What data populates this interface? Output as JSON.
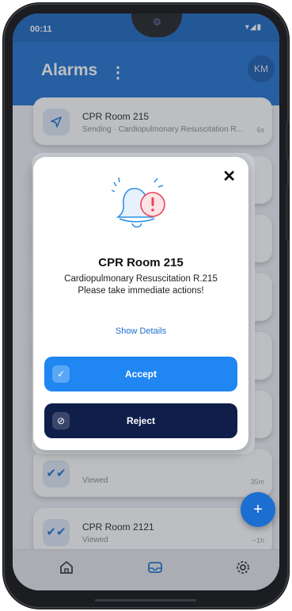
{
  "status_bar": {
    "time": "00:11",
    "icons": "▾◢▮"
  },
  "header": {
    "title": "Alarms",
    "menu_glyph": "⋮",
    "avatar_initials": "KM"
  },
  "list": [
    {
      "title": "CPR Room 215",
      "status": "Sending",
      "detail": "Cardiopulmonary Resuscitation R...",
      "time": "6s"
    },
    {
      "title": "",
      "status": "Viewed",
      "detail": "",
      "time": "35m"
    },
    {
      "title": "CPR Room 2121",
      "status": "Viewed",
      "detail": "",
      "time": "~1h"
    }
  ],
  "fab": {
    "glyph": "+"
  },
  "modal": {
    "title": "CPR Room 215",
    "message_line1": "Cardiopulmonary Resuscitation R.215",
    "message_line2": "Please take immediate actions!",
    "details_link": "Show Details",
    "accept_label": "Accept",
    "reject_label": "Reject",
    "close_glyph": "✕"
  },
  "colors": {
    "primary": "#1c6fd1",
    "accept": "#1f86f2",
    "reject": "#0f1f4a",
    "alert": "#e8455a"
  }
}
